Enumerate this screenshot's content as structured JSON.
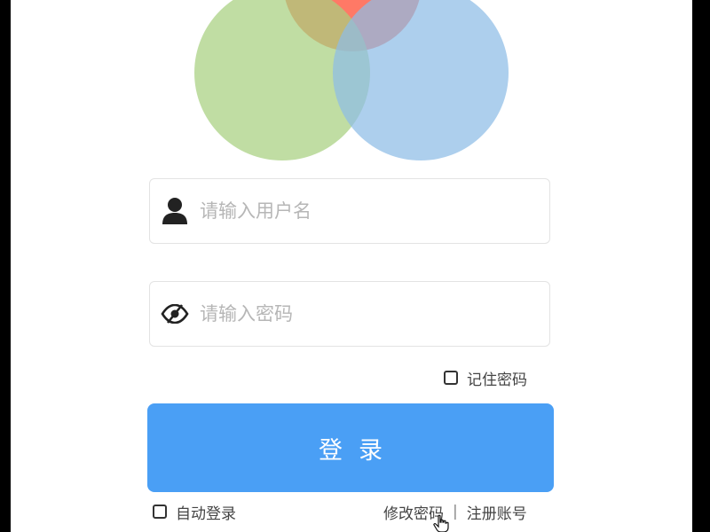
{
  "logo": {
    "circles": [
      {
        "color": "#ff6a55"
      },
      {
        "color": "#a8d07f"
      },
      {
        "color": "#8ebde6"
      }
    ]
  },
  "username": {
    "placeholder": "请输入用户名",
    "icon": "user-icon"
  },
  "password": {
    "placeholder": "请输入密码",
    "icon": "eye-slash-icon"
  },
  "remember_password": {
    "label": "记住密码",
    "checked": false
  },
  "login_button": {
    "label": "登录"
  },
  "auto_login": {
    "label": "自动登录",
    "checked": false
  },
  "links": {
    "change_password": "修改密码",
    "separator": "|",
    "register": "注册账号"
  },
  "colors": {
    "primary": "#4a9ff5",
    "background": "#ffffff"
  }
}
